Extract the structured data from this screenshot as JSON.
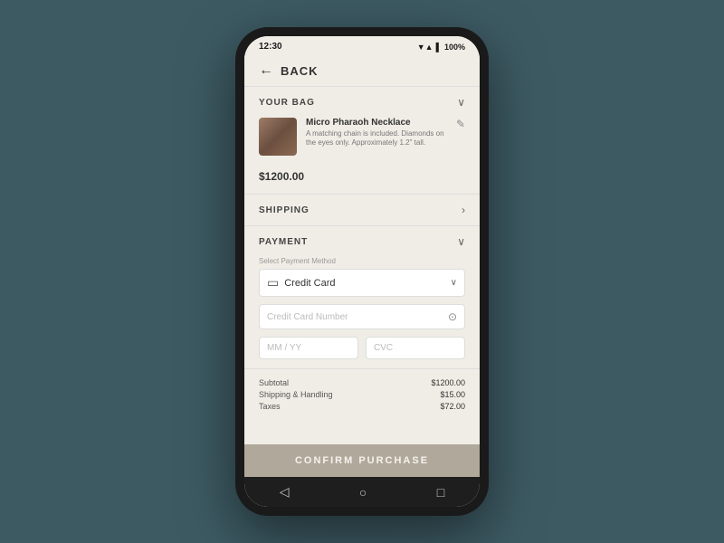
{
  "statusBar": {
    "time": "12:30",
    "battery": "100%",
    "icons": "▼▲▌"
  },
  "header": {
    "backLabel": "BACK"
  },
  "bag": {
    "sectionLabel": "YOUR BAG",
    "item": {
      "name": "Micro Pharaoh Necklace",
      "description": "A matching chain is included. Diamonds on the eyes only. Approximately 1.2\" tall.",
      "price": "$1200.00"
    },
    "chevron": "chevron-down"
  },
  "shipping": {
    "sectionLabel": "SHIPPING",
    "chevron": "chevron-right"
  },
  "payment": {
    "sectionLabel": "PAYMENT",
    "chevron": "chevron-down",
    "methodLabel": "Select Payment Method",
    "selectedMethod": "Credit Card",
    "cardNumberPlaceholder": "Credit Card Number",
    "mmyyPlaceholder": "MM / YY",
    "cvcPlaceholder": "CVC"
  },
  "totals": {
    "subtotalLabel": "Subtotal",
    "subtotalValue": "$1200.00",
    "shippingLabel": "Shipping & Handling",
    "shippingValue": "$15.00",
    "taxesLabel": "Taxes",
    "taxesValue": "$72.00"
  },
  "confirmButton": {
    "label": "CONFIRM PURCHASE"
  },
  "navBar": {
    "back": "◁",
    "home": "○",
    "recent": "□"
  }
}
